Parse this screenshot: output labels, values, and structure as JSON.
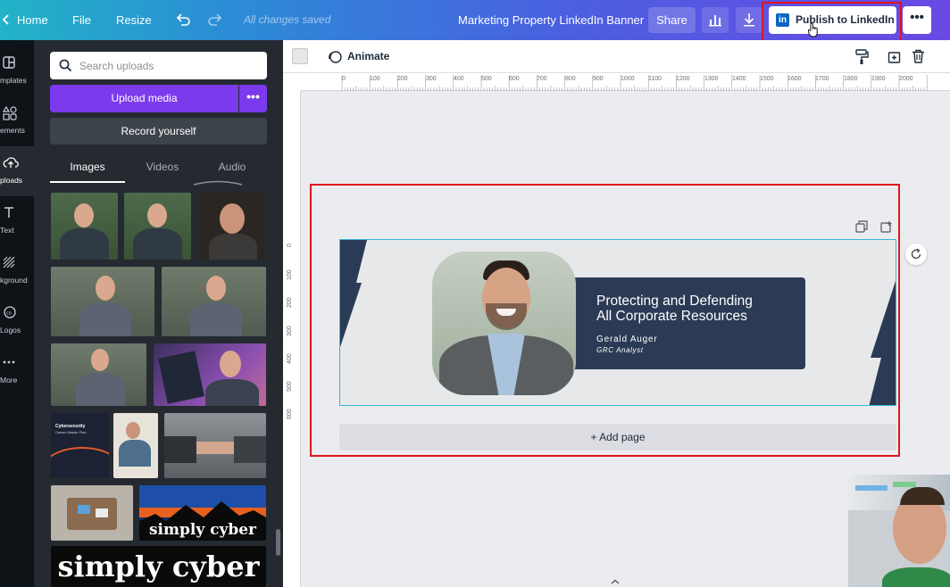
{
  "topbar": {
    "home": "Home",
    "file": "File",
    "resize": "Resize",
    "saved_status": "All changes saved",
    "doc_title": "Marketing Property LinkedIn Banner",
    "share": "Share",
    "publish": "Publish to LinkedIn",
    "publish_logo": "in",
    "more": "•••"
  },
  "rail": {
    "items": [
      {
        "label": "mplates",
        "icon": "templates-icon"
      },
      {
        "label": "ements",
        "icon": "elements-icon"
      },
      {
        "label": "ploads",
        "icon": "uploads-icon"
      },
      {
        "label": "Text",
        "icon": "text-icon"
      },
      {
        "label": "kground",
        "icon": "background-icon"
      },
      {
        "label": "Logos",
        "icon": "logos-icon"
      },
      {
        "label": "More",
        "icon": "more-icon"
      }
    ]
  },
  "panel": {
    "search_placeholder": "Search uploads",
    "upload_media": "Upload media",
    "upload_more": "•••",
    "record": "Record yourself",
    "tabs": [
      "Images",
      "Videos",
      "Audio"
    ],
    "simply_cyber": "simply cyber",
    "cyber_card_title": "Cybersecurity",
    "cyber_card_sub": "Career Master Plan"
  },
  "canvas": {
    "animate": "Animate",
    "ruler_h": [
      "0",
      "100",
      "200",
      "300",
      "400",
      "500",
      "600",
      "700",
      "800",
      "900",
      "1000",
      "1100",
      "1200",
      "1300",
      "1400",
      "1500",
      "1600",
      "1700",
      "1800",
      "1900",
      "2000"
    ],
    "ruler_v": [
      "0",
      "100",
      "200",
      "300",
      "400",
      "500",
      "600"
    ],
    "banner": {
      "title_line1": "Protecting and Defending",
      "title_line2": "All Corporate Resources",
      "name": "Gerald Auger",
      "role": "GRC Analyst"
    },
    "add_page": "+ Add page"
  },
  "colors": {
    "accent_purple": "#7c3aed",
    "banner_navy": "#2b3a55",
    "highlight_red": "#e0141c",
    "linkedin_blue": "#0a66c2"
  }
}
